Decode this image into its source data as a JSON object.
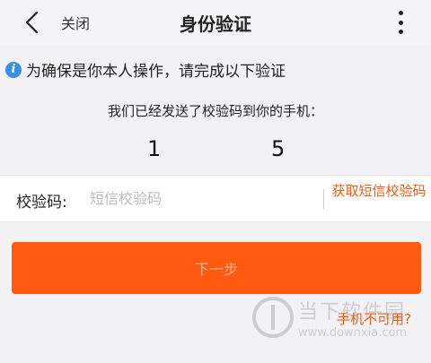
{
  "header": {
    "back_icon": "chevron-left-icon",
    "close_label": "关闭",
    "title": "身份验证",
    "more_icon": "vertical-dots-icon"
  },
  "notice": {
    "icon": "info-icon",
    "icon_glyph": "i",
    "text": "为确保是你本人操作，请完成以下验证"
  },
  "sent_message": "我们已经发送了校验码到你的手机：",
  "phone": {
    "visible_start": "1",
    "visible_end": "5"
  },
  "code_field": {
    "label": "校验码:",
    "placeholder": "短信校验码",
    "value": ""
  },
  "get_code_label": "获取短信校验码",
  "next_label": "下一步",
  "phone_unavailable_label": "手机不可用?",
  "watermark": {
    "text": "当下软件园",
    "url": "www.downxia.com"
  },
  "colors": {
    "accent": "#ff5a10",
    "link": "#f25c16",
    "info": "#3a8ee6",
    "background": "#f2f2f4"
  }
}
